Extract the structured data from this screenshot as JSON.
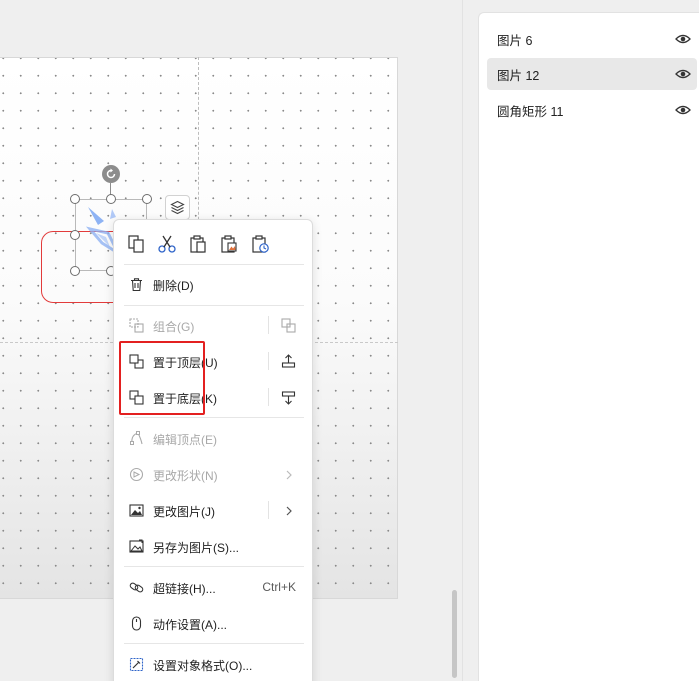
{
  "objects_pane": {
    "items": [
      {
        "label": "图片 6",
        "selected": false
      },
      {
        "label": "图片 12",
        "selected": true
      },
      {
        "label": "圆角矩形 11",
        "selected": false
      }
    ]
  },
  "context_menu": {
    "toolbar": [
      {
        "icon": "copy-icon"
      },
      {
        "icon": "cut-icon"
      },
      {
        "icon": "paste-icon"
      },
      {
        "icon": "paste-as-picture-icon"
      },
      {
        "icon": "paste-special-icon"
      }
    ],
    "delete": "删除(D)",
    "group": "组合(G)",
    "bring_to_front": "置于顶层(U)",
    "send_to_back": "置于底层(K)",
    "edit_points": "编辑顶点(E)",
    "change_shape": "更改形状(N)",
    "change_picture": "更改图片(J)",
    "save_as_picture": "另存为图片(S)...",
    "hyperlink": "超链接(H)...",
    "hyperlink_shortcut": "Ctrl+K",
    "action_settings": "动作设置(A)...",
    "format_object": "设置对象格式(O)..."
  },
  "colors": {
    "accent_red": "#e32020",
    "picture_blue": "#6f9bef"
  }
}
